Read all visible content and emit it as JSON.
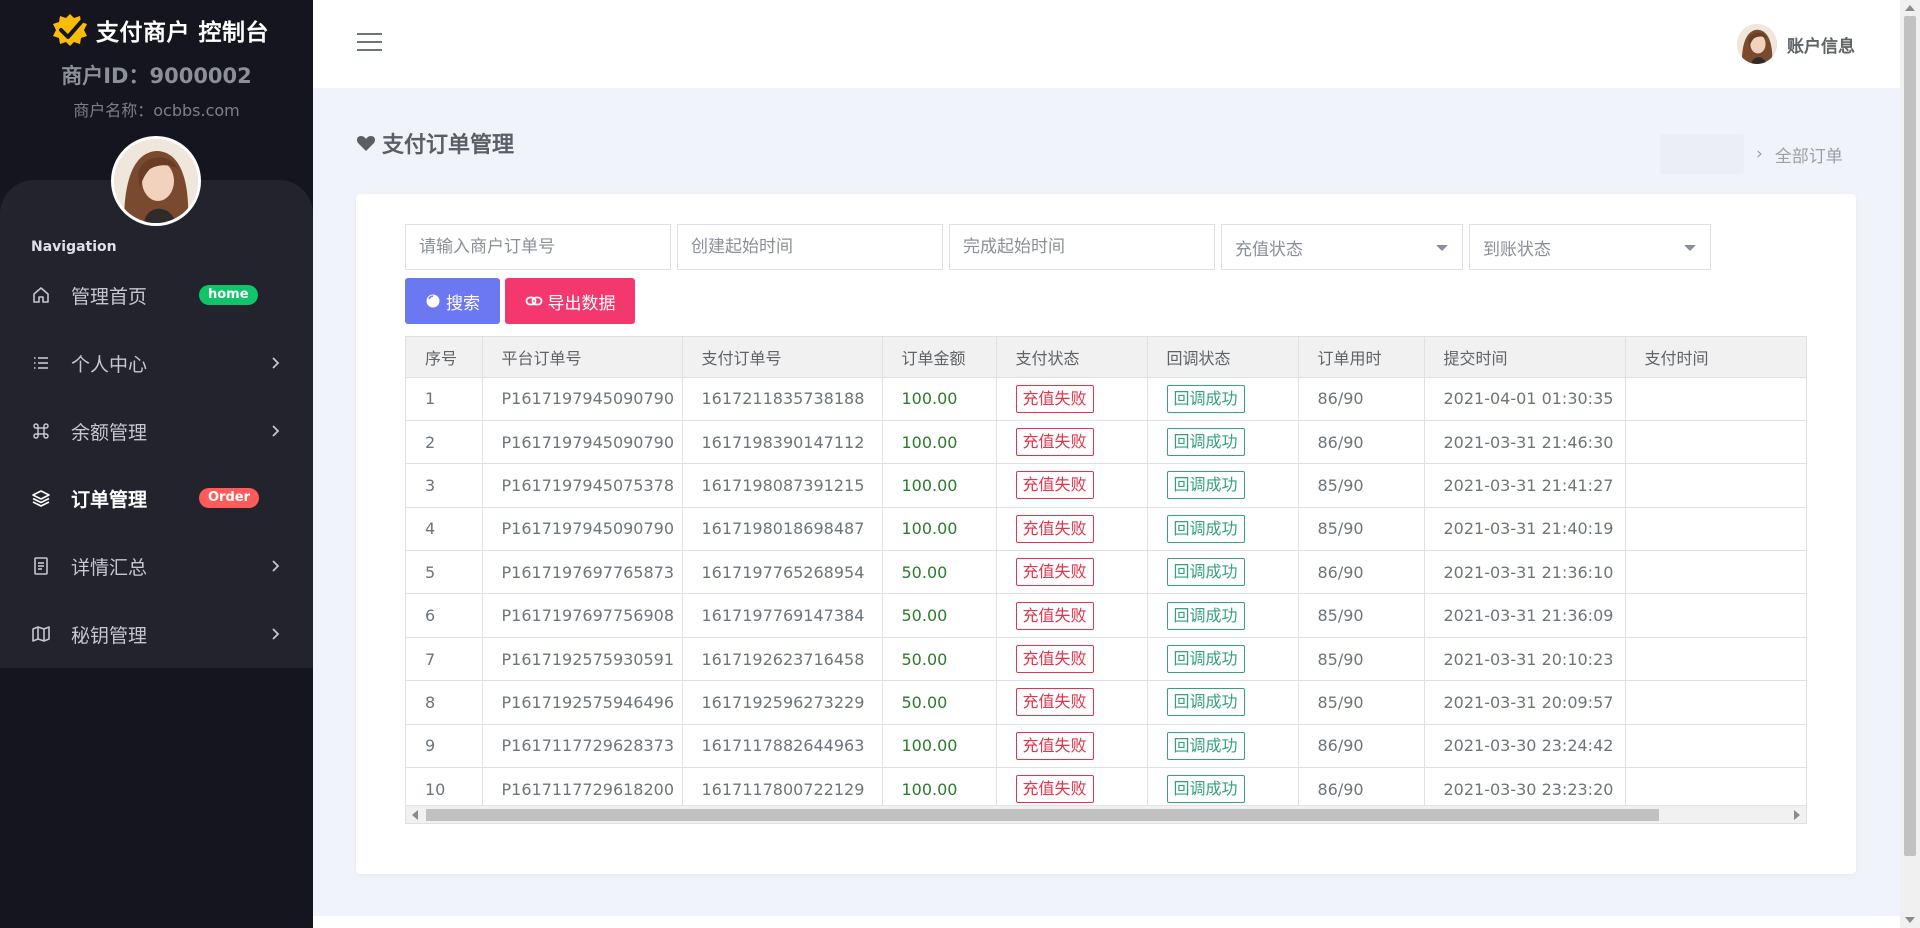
{
  "sidebar": {
    "brand_title": "支付商户 控制台",
    "merchant_id": "商户ID：9000002",
    "merchant_name": "商户名称：ocbbs.com",
    "nav_heading": "Navigation",
    "items": [
      {
        "label": "管理首页",
        "icon": "home-icon",
        "badge": "home",
        "badge_color": "#10c469"
      },
      {
        "label": "个人中心",
        "icon": "list-icon",
        "chevron": true
      },
      {
        "label": "余额管理",
        "icon": "command-icon",
        "chevron": true
      },
      {
        "label": "订单管理",
        "icon": "layers-icon",
        "badge": "Order",
        "badge_color": "#ff5b5b",
        "active": true
      },
      {
        "label": "详情汇总",
        "icon": "document-icon",
        "chevron": true
      },
      {
        "label": "秘钥管理",
        "icon": "map-icon",
        "chevron": true
      }
    ]
  },
  "topbar": {
    "account_label": "账户信息"
  },
  "page": {
    "title": "支付订单管理",
    "breadcrumb_current": "全部订单"
  },
  "filters": {
    "order_no_placeholder": "请输入商户订单号",
    "create_time_placeholder": "创建起始时间",
    "finish_time_placeholder": "完成起始时间",
    "recharge_status": "充值状态",
    "arrival_status": "到账状态"
  },
  "buttons": {
    "search": "搜索",
    "export": "导出数据"
  },
  "table": {
    "headers": [
      "序号",
      "平台订单号",
      "支付订单号",
      "订单金额",
      "支付状态",
      "回调状态",
      "订单用时",
      "提交时间",
      "支付时间"
    ],
    "rows": [
      {
        "no": "1",
        "platform_no": "P1617197945090790",
        "pay_no": "1617211835738188",
        "amount": "100.00",
        "pay_status": "充值失败",
        "callback_status": "回调成功",
        "duration": "86/90",
        "submit_time": "2021-04-01 01:30:35",
        "pay_time": ""
      },
      {
        "no": "2",
        "platform_no": "P1617197945090790",
        "pay_no": "1617198390147112",
        "amount": "100.00",
        "pay_status": "充值失败",
        "callback_status": "回调成功",
        "duration": "86/90",
        "submit_time": "2021-03-31 21:46:30",
        "pay_time": ""
      },
      {
        "no": "3",
        "platform_no": "P1617197945075378",
        "pay_no": "1617198087391215",
        "amount": "100.00",
        "pay_status": "充值失败",
        "callback_status": "回调成功",
        "duration": "85/90",
        "submit_time": "2021-03-31 21:41:27",
        "pay_time": ""
      },
      {
        "no": "4",
        "platform_no": "P1617197945090790",
        "pay_no": "1617198018698487",
        "amount": "100.00",
        "pay_status": "充值失败",
        "callback_status": "回调成功",
        "duration": "85/90",
        "submit_time": "2021-03-31 21:40:19",
        "pay_time": ""
      },
      {
        "no": "5",
        "platform_no": "P1617197697765873",
        "pay_no": "1617197765268954",
        "amount": "50.00",
        "pay_status": "充值失败",
        "callback_status": "回调成功",
        "duration": "86/90",
        "submit_time": "2021-03-31 21:36:10",
        "pay_time": ""
      },
      {
        "no": "6",
        "platform_no": "P1617197697756908",
        "pay_no": "1617197769147384",
        "amount": "50.00",
        "pay_status": "充值失败",
        "callback_status": "回调成功",
        "duration": "85/90",
        "submit_time": "2021-03-31 21:36:09",
        "pay_time": ""
      },
      {
        "no": "7",
        "platform_no": "P1617192575930591",
        "pay_no": "1617192623716458",
        "amount": "50.00",
        "pay_status": "充值失败",
        "callback_status": "回调成功",
        "duration": "85/90",
        "submit_time": "2021-03-31 20:10:23",
        "pay_time": ""
      },
      {
        "no": "8",
        "platform_no": "P1617192575946496",
        "pay_no": "1617192596273229",
        "amount": "50.00",
        "pay_status": "充值失败",
        "callback_status": "回调成功",
        "duration": "85/90",
        "submit_time": "2021-03-31 20:09:57",
        "pay_time": ""
      },
      {
        "no": "9",
        "platform_no": "P1617117729628373",
        "pay_no": "1617117882644963",
        "amount": "100.00",
        "pay_status": "充值失败",
        "callback_status": "回调成功",
        "duration": "86/90",
        "submit_time": "2021-03-30 23:24:42",
        "pay_time": ""
      },
      {
        "no": "10",
        "platform_no": "P1617117729618200",
        "pay_no": "1617117800722129",
        "amount": "100.00",
        "pay_status": "充值失败",
        "callback_status": "回调成功",
        "duration": "86/90",
        "submit_time": "2021-03-30 23:23:20",
        "pay_time": ""
      }
    ]
  },
  "colors": {
    "sidebar_bg": "#15151f",
    "accent_primary": "#6b78f2",
    "accent_danger": "#f4376d",
    "status_fail": "#e5334b",
    "status_ok": "#35a27c",
    "logo": "#f9bc0b"
  }
}
